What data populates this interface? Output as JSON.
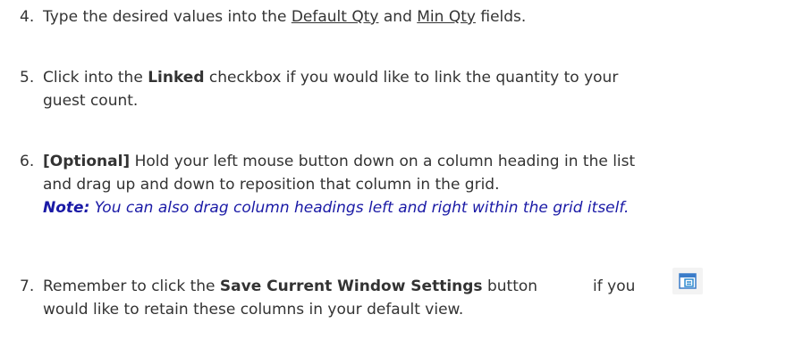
{
  "steps": [
    {
      "num": "4.",
      "pre": "Type the desired values into the ",
      "link1": "Default Qty",
      "mid": " and ",
      "link2": "Min Qty",
      "post": " fields."
    },
    {
      "num": "5.",
      "pre": "Click into the ",
      "bold": "Linked",
      "post": " checkbox if you would like to link the quantity to your",
      "line2": "guest count."
    },
    {
      "num": "6.",
      "bold": "[Optional]",
      "post": " Hold your left mouse button down on a column heading in the list",
      "line2": "and drag up and down to reposition that column in the grid.",
      "note_label": "Note:",
      "note_text": " You can also drag column headings left and right within the grid itself."
    },
    {
      "num": "7.",
      "pre": "Remember to click the ",
      "bold": "Save Current Window Settings",
      "mid": " button",
      "post": "if you",
      "line2": "would like to retain these columns in your default view.",
      "icon": "save-window-settings-icon"
    }
  ]
}
